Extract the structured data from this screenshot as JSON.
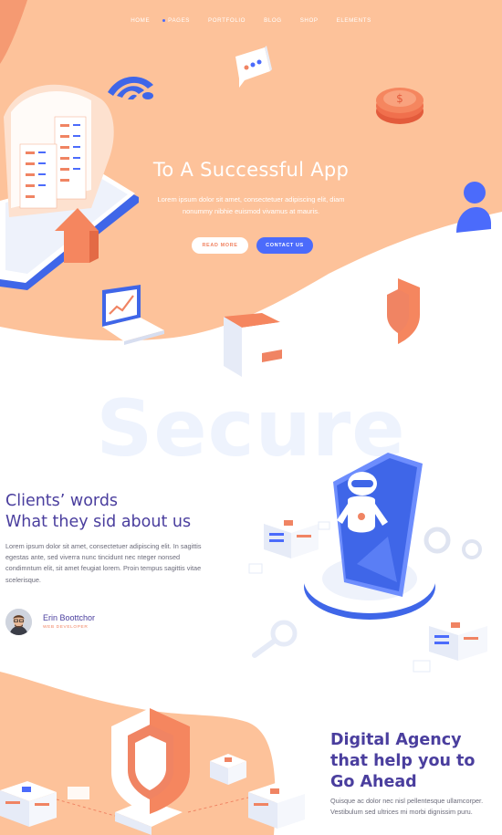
{
  "nav": {
    "items": [
      "HOME",
      "PAGES",
      "PORTFOLIO",
      "BLOG",
      "SHOP",
      "ELEMENTS"
    ]
  },
  "hero": {
    "title": "To A Successful App",
    "subtitle": "Lorem ipsum dolor sit amet, consectetuer adipiscing elit, diam nonummy nibhie euismod vivamus at mauris.",
    "read_more": "READ MORE",
    "contact_us": "CONTACT US"
  },
  "secure": {
    "watermark": "Secure"
  },
  "clients": {
    "title_line1": "Clients’ words",
    "title_line2": "What they sid about us",
    "text": "Lorem ipsum dolor sit amet, consectetuer adipiscing elit. In sagittis egestas ante, sed viverra nunc tincidunt nec nteger nonsed condimntum elit, sit amet feugiat lorem. Proin tempus sagittis vitae scelerisque.",
    "person_name": "Erin Boottchor",
    "person_role": "WEB DEVELOPER"
  },
  "agency": {
    "title_line1": "Digital Agency",
    "title_line2": "that help you to",
    "title_line3": "Go Ahead",
    "text": "Quisque ac dolor nec nisl pellentesque ullamcorper. Vestibulum sed ultrices mi morbi dignissim puru."
  },
  "colors": {
    "peach": "#fdbf95",
    "coral": "#f08463",
    "blue": "#4b6bfb",
    "indigo": "#4a3e9e"
  }
}
